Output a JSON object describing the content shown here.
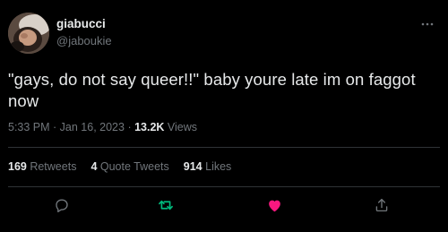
{
  "user": {
    "display_name": "giabucci",
    "handle": "@jaboukie"
  },
  "tweet": {
    "text": "\"gays, do not say queer!!\" baby youre late im on faggot now"
  },
  "meta": {
    "time": "5:33 PM",
    "separator_1": " · ",
    "date": "Jan 16, 2023",
    "separator_2": " · ",
    "views_count": "13.2K",
    "views_label": " Views"
  },
  "stats": {
    "retweets_count": "169",
    "retweets_label": " Retweets",
    "quote_tweets_count": "4",
    "quote_tweets_label": " Quote Tweets",
    "likes_count": "914",
    "likes_label": " Likes"
  },
  "colors": {
    "background": "#000000",
    "primary_text": "#e7e9ea",
    "secondary_text": "#71767b",
    "divider": "#2f3336",
    "retweet_green": "#00ba7c",
    "like_pink": "#f91880"
  },
  "icons": {
    "more": "more-horizontal-icon",
    "reply": "reply-bubble-icon",
    "retweet": "retweet-arrows-icon",
    "like": "heart-filled-icon",
    "share": "share-upload-icon"
  }
}
